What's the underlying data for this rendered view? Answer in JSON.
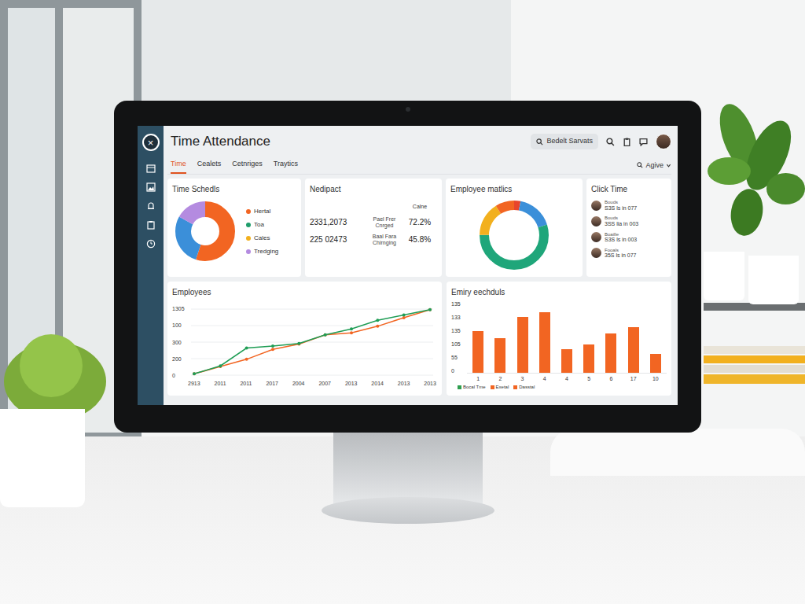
{
  "window": {
    "title": "Time Attendance",
    "close_icon": "×"
  },
  "search": {
    "text": "Bedelt Sarvats"
  },
  "tabs": [
    {
      "label": "Time",
      "selected": true
    },
    {
      "label": "Cealets",
      "selected": false
    },
    {
      "label": "Cetnriges",
      "selected": false
    },
    {
      "label": "Traytics",
      "selected": false
    }
  ],
  "filter": {
    "label": "Agive"
  },
  "time_schedules": {
    "title": "Time Schedls",
    "segments": [
      {
        "value": 55,
        "color": "#f26522"
      },
      {
        "value": 28,
        "color": "#3b8fd9"
      },
      {
        "value": 17,
        "color": "#b48be0"
      }
    ],
    "legend": [
      {
        "label": "Hertal",
        "color": "#f26522"
      },
      {
        "label": "Toa",
        "color": "#1f9d6b"
      },
      {
        "label": "Cales",
        "color": "#f2b01e"
      },
      {
        "label": "Tredging",
        "color": "#b48be0"
      }
    ]
  },
  "nedipact": {
    "title": "Nedipact",
    "header": "Calne",
    "rows": [
      {
        "value": "2331,2073",
        "label": "Pael Frer Cnrged",
        "percent": "72.2%"
      },
      {
        "value": "225 02473",
        "label": "Baal Fara Chirnging",
        "percent": "45.8%"
      }
    ]
  },
  "employee_metrics": {
    "title": "Employee matlics",
    "segments": [
      {
        "value": 3,
        "color": "#e8452c"
      },
      {
        "value": 17,
        "color": "#3b8fd9"
      },
      {
        "value": 55,
        "color": "#1fa67a"
      },
      {
        "value": 16,
        "color": "#f2b01e"
      },
      {
        "value": 9,
        "color": "#f26522"
      }
    ]
  },
  "clock_time": {
    "title": "Click Time",
    "entries": [
      {
        "name": "Bouds",
        "detail": "S3S ls in 077"
      },
      {
        "name": "Bouds",
        "detail": "3SS lia in 003"
      },
      {
        "name": "Boaille",
        "detail": "S3S ls in 003"
      },
      {
        "name": "Fooals",
        "detail": "35S ls in 077"
      }
    ]
  },
  "employees_chart": {
    "title": "Employees",
    "y_ticks": [
      "1305",
      "100",
      "300",
      "200",
      "0"
    ],
    "x_labels": [
      "2913",
      "2011",
      "2011",
      "2017",
      "2004",
      "2007",
      "2013",
      "2014",
      "2013",
      "2013"
    ],
    "series": [
      {
        "color": "#f26522",
        "values": [
          2,
          13,
          24,
          39,
          47,
          61,
          64,
          74,
          87,
          99
        ]
      },
      {
        "color": "#1f9d55",
        "values": [
          2,
          14,
          41,
          44,
          48,
          61,
          70,
          83,
          91,
          99
        ]
      }
    ]
  },
  "schedules_chart": {
    "title": "Emiry eechduls",
    "y_ticks": [
      "135",
      "133",
      "135",
      "105",
      "55",
      "0"
    ],
    "x_labels": [
      "1",
      "2",
      "3",
      "4",
      "4",
      "5",
      "6",
      "17",
      "10"
    ],
    "values": [
      58,
      48,
      78,
      85,
      33,
      40,
      55,
      64,
      26
    ],
    "legend": [
      {
        "label": "Bocal Tme",
        "color": "#2e9e4f"
      },
      {
        "label": "Exetal",
        "color": "#f26522"
      },
      {
        "label": "Dasstal",
        "color": "#f26522"
      }
    ]
  }
}
